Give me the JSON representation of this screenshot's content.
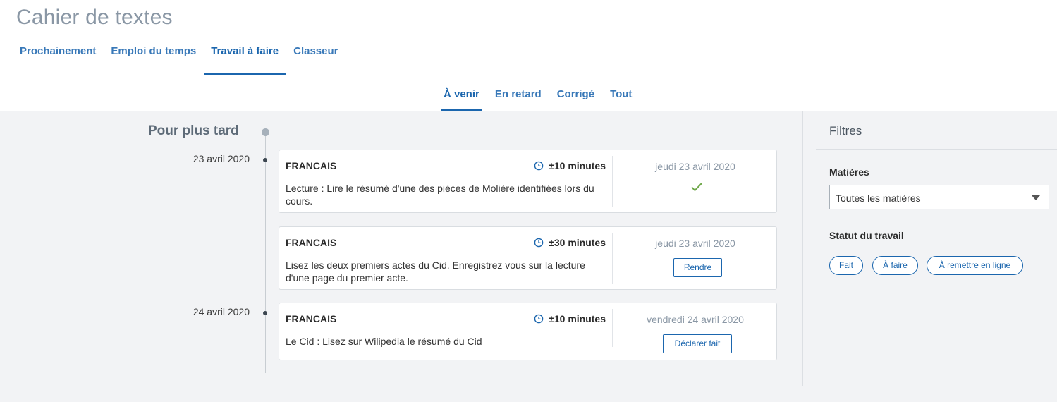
{
  "header": {
    "title": "Cahier de textes",
    "tabs": [
      {
        "label": "Prochainement"
      },
      {
        "label": "Emploi du temps"
      },
      {
        "label": "Travail à faire"
      },
      {
        "label": "Classeur"
      }
    ],
    "active_tab": "Travail à faire"
  },
  "subnav": {
    "tabs": [
      {
        "label": "À venir"
      },
      {
        "label": "En retard"
      },
      {
        "label": "Corrigé"
      },
      {
        "label": "Tout"
      }
    ],
    "active_tab": "À venir"
  },
  "timeline": {
    "section_title": "Pour plus tard",
    "groups": [
      {
        "date": "23 avril 2020",
        "items": [
          {
            "subject": "FRANCAIS",
            "duration": "±10 minutes",
            "description": "Lecture : Lire le résumé d'une des pièces de Molière  identifiées lors du cours.",
            "due_date": "jeudi 23 avril 2020",
            "status_icon": "check-icon",
            "status_color": "#6fa84a"
          },
          {
            "subject": "FRANCAIS",
            "duration": "±30 minutes",
            "description": "Lisez les deux premiers actes du Cid. Enregistrez vous sur la lecture d'une page du premier acte.",
            "due_date": "jeudi 23 avril 2020",
            "action_label": "Rendre"
          }
        ]
      },
      {
        "date": "24 avril 2020",
        "items": [
          {
            "subject": "FRANCAIS",
            "duration": "±10 minutes",
            "description": "Le Cid : Lisez sur Wilipedia le résumé du Cid",
            "due_date": "vendredi 24 avril 2020",
            "action_label": "Déclarer fait"
          }
        ]
      }
    ]
  },
  "filters": {
    "title": "Filtres",
    "subjects_label": "Matières",
    "subjects_selected": "Toutes les matières",
    "status_label": "Statut du travail",
    "status_options": [
      "Fait",
      "À faire",
      "À remettre en ligne"
    ]
  },
  "colors": {
    "accent": "#1b66ae",
    "link": "#3878b8",
    "muted": "#8a97a5",
    "background": "#f2f3f5"
  }
}
